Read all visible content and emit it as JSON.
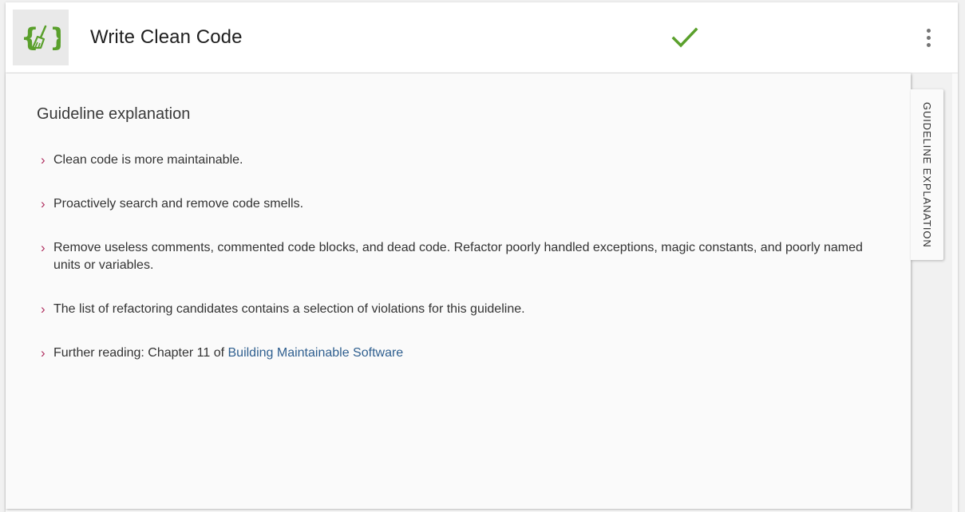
{
  "header": {
    "title": "Write Clean Code",
    "logo_icon": "curly-braces-broom-icon",
    "status_icon": "check-icon",
    "status_color": "#5aa02c",
    "more_icon": "more-vertical-icon"
  },
  "panel": {
    "heading": "Guideline explanation",
    "bullets": [
      "Clean code is more maintainable.",
      "Proactively search and remove code smells.",
      "Remove useless comments, commented code blocks, and dead code. Refactor poorly handled exceptions, magic constants, and poorly named units or variables.",
      "The list of refactoring candidates contains a selection of violations for this guideline."
    ],
    "further_reading": {
      "prefix": "Further reading: Chapter 11 of ",
      "link_text": "Building Maintainable Software"
    },
    "bullet_icon": "chevron-right-icon",
    "bullet_color": "#b03060"
  },
  "side_tab": {
    "label": "Guideline explanation"
  }
}
